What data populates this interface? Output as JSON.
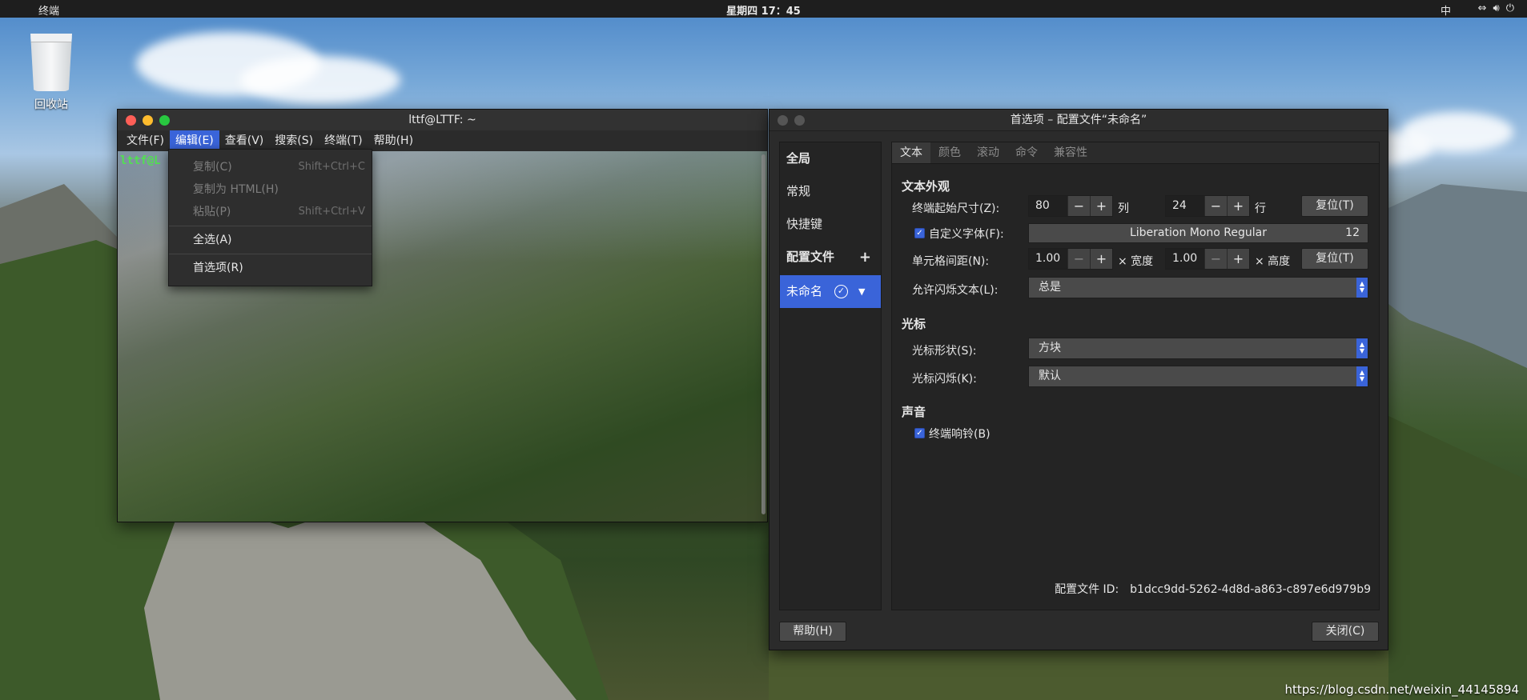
{
  "topbar": {
    "app_name": "终端",
    "clock": "星期四 17：45",
    "ime": "中"
  },
  "desktop": {
    "trash_label": "回收站"
  },
  "terminal": {
    "title": "lttf@LTTF: ~",
    "prompt": "lttf@L",
    "menus": [
      "文件(F)",
      "编辑(E)",
      "查看(V)",
      "搜索(S)",
      "终端(T)",
      "帮助(H)"
    ],
    "active_menu": "编辑(E)"
  },
  "edit_menu": {
    "copy": "复制(C)",
    "copy_shortcut": "Shift+Ctrl+C",
    "copy_html": "复制为 HTML(H)",
    "paste": "粘贴(P)",
    "paste_shortcut": "Shift+Ctrl+V",
    "select_all": "全选(A)",
    "preferences": "首选项(R)"
  },
  "prefs": {
    "title": "首选项 – 配置文件“未命名”",
    "sidebar": {
      "global": "全局",
      "general": "常规",
      "shortcuts": "快捷键",
      "profiles": "配置文件",
      "profile_name": "未命名"
    },
    "tabs": [
      "文本",
      "颜色",
      "滚动",
      "命令",
      "兼容性"
    ],
    "text_appearance": {
      "section": "文本外观",
      "initial_size_label": "终端起始尺寸(Z):",
      "columns": "80",
      "columns_unit": "列",
      "rows": "24",
      "rows_unit": "行",
      "reset_label": "复位(T)",
      "custom_font_label": "自定义字体(F):",
      "custom_font_checked": true,
      "font_name": "Liberation Mono Regular",
      "font_size": "12",
      "cell_spacing_label": "单元格间距(N):",
      "width_value": "1.00",
      "width_unit": "× 宽度",
      "height_value": "1.00",
      "height_unit": "× 高度",
      "blink_text_label": "允许闪烁文本(L):",
      "blink_text_value": "总是"
    },
    "cursor": {
      "section": "光标",
      "shape_label": "光标形状(S):",
      "shape_value": "方块",
      "blink_label": "光标闪烁(K):",
      "blink_value": "默认"
    },
    "sound": {
      "section": "声音",
      "bell_label": "终端响铃(B)",
      "bell_checked": true
    },
    "profile_id_label": "配置文件 ID:",
    "profile_id": "b1dcc9dd-5262-4d8d-a863-c897e6d979b9",
    "help_button": "帮助(H)",
    "close_button": "关闭(C)"
  },
  "watermark": "https://blog.csdn.net/weixin_44145894",
  "colors": {
    "accent": "#3a64d9",
    "close": "#ff5f57",
    "minimize": "#febc2e",
    "maximize": "#28c840",
    "prompt": "#52e052"
  }
}
